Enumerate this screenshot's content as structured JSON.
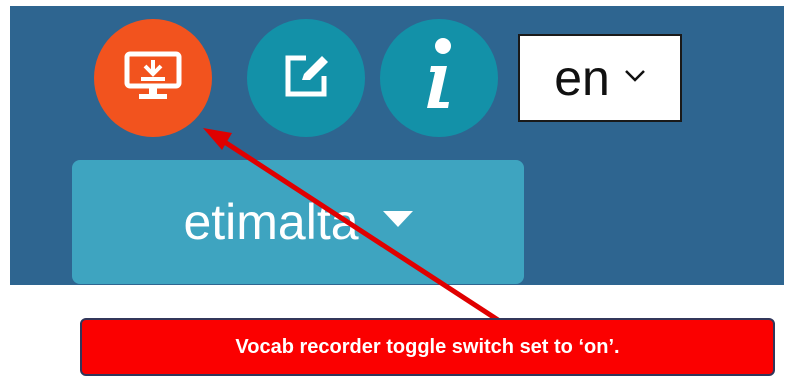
{
  "icons": {
    "recorder": "monitor-download-icon",
    "edit": "edit-icon",
    "info": "info-icon",
    "chevron": "chevron-down-icon",
    "caret": "caret-down-icon"
  },
  "colors": {
    "panel_bg": "#2e6590",
    "recorder_on": "#f2531e",
    "button_teal": "#1391a8",
    "dropdown_bg": "#3ea4c0",
    "callout_bg": "#fb0000",
    "arrow": "#e00000"
  },
  "toolbar": {
    "recorder_toggle_state": "on",
    "language": {
      "selected": "en"
    },
    "word_dropdown": {
      "label": "etimalta"
    }
  },
  "annotation": {
    "callout_text": "Vocab recorder toggle switch set to ‘on’."
  }
}
